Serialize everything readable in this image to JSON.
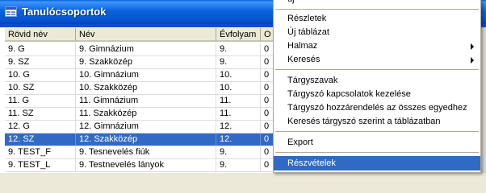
{
  "window": {
    "title": "Tanulócsoportok"
  },
  "table": {
    "columns": [
      "Rövid név",
      "Név",
      "Évfolyam",
      "O"
    ],
    "rows": [
      [
        "9. G",
        "9. Gimnázium",
        "9.",
        "0"
      ],
      [
        "9. SZ",
        "9. Szakközép",
        "9.",
        "0"
      ],
      [
        "10. G",
        "10. Gimnázium",
        "10.",
        "0"
      ],
      [
        "10. SZ",
        "10. Szakközép",
        "10.",
        "0"
      ],
      [
        "11. G",
        "11. Gimnázium",
        "11.",
        "0"
      ],
      [
        "11. SZ",
        "11. Szakközép",
        "11.",
        "0"
      ],
      [
        "12. G",
        "12. Gimnázium",
        "12.",
        "0"
      ],
      [
        "12. SZ",
        "12. Szakközép",
        "12.",
        "0"
      ],
      [
        "9. TEST_F",
        "9. Tesnevelés fiúk",
        "9.",
        "0"
      ],
      [
        "9. TEST_L",
        "9. Testnevelés lányok",
        "9.",
        "0"
      ]
    ],
    "selected_row": "12. SZ"
  },
  "context_menu": {
    "top_partial": "új",
    "items": [
      {
        "label": "Részletek",
        "submenu": false
      },
      {
        "label": "Új táblázat",
        "submenu": false
      },
      {
        "label": "Halmaz",
        "submenu": true
      },
      {
        "label": "Keresés",
        "submenu": true
      },
      {
        "label": "Tárgyszavak",
        "submenu": false
      },
      {
        "label": "Tárgyszó kapcsolatok kezelése",
        "submenu": false
      },
      {
        "label": "Tárgyszó hozzárendelés az összes egyedhez",
        "submenu": false
      },
      {
        "label": "Keresés tárgyszó szerint a táblázatban",
        "submenu": false
      },
      {
        "label": "Export",
        "submenu": false
      },
      {
        "label": "Részvételek",
        "submenu": false,
        "highlighted": true
      }
    ]
  },
  "colors": {
    "titlebar": "#0a5fd8",
    "selection": "#316ac5",
    "menu_bg": "#ffffff"
  },
  "icons": {
    "window": "app-window-icon",
    "submenu": "chevron-right-icon"
  }
}
